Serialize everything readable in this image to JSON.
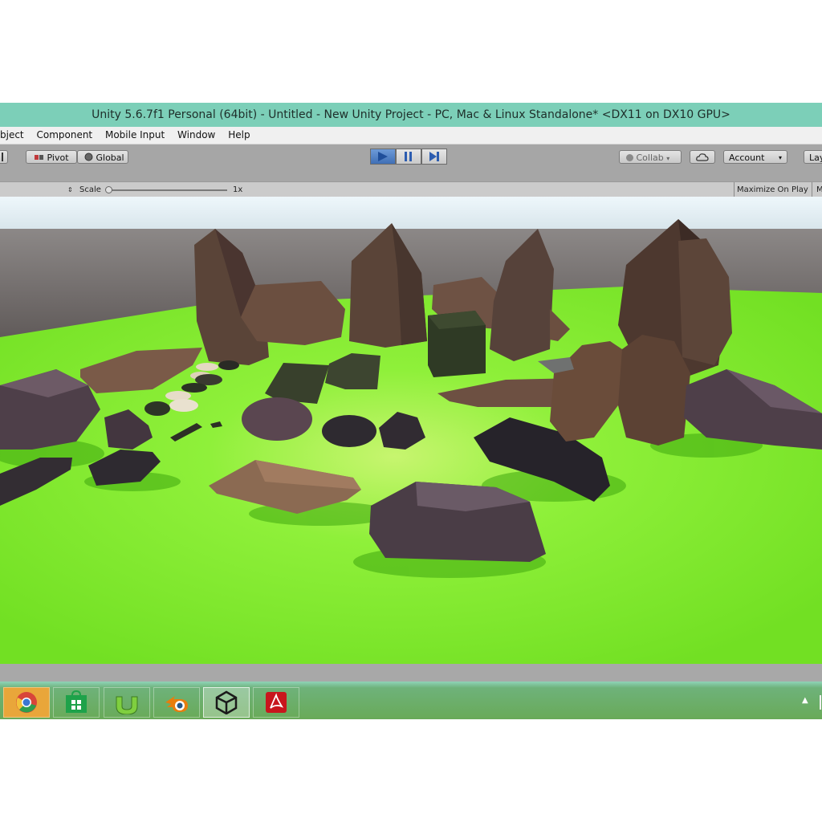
{
  "window": {
    "title": "Unity 5.6.7f1 Personal (64bit) - Untitled - New Unity Project - PC, Mac & Linux Standalone* <DX11 on DX10 GPU>"
  },
  "menu": [
    "bject",
    "Component",
    "Mobile Input",
    "Window",
    "Help"
  ],
  "toolbar": {
    "pivot_label": "Pivot",
    "global_label": "Global",
    "collab_label": "Collab",
    "account_label": "Account",
    "layers_label": "Lay"
  },
  "game_view": {
    "scale_label": "Scale",
    "scale_value": "1x",
    "maximize_label": "Maximize On Play",
    "overflow_label": "M"
  },
  "taskbar": {
    "items": [
      "chrome-icon",
      "store-icon",
      "utorrent-icon",
      "blender-icon",
      "unity-icon",
      "acrobat-icon"
    ]
  },
  "colors": {
    "title_bar": "#7ccfb8",
    "toolbar": "#a6a6a6",
    "play_active": "#4a7bc4",
    "ground": "#7fe62e",
    "taskbar": "#6cae5c"
  }
}
